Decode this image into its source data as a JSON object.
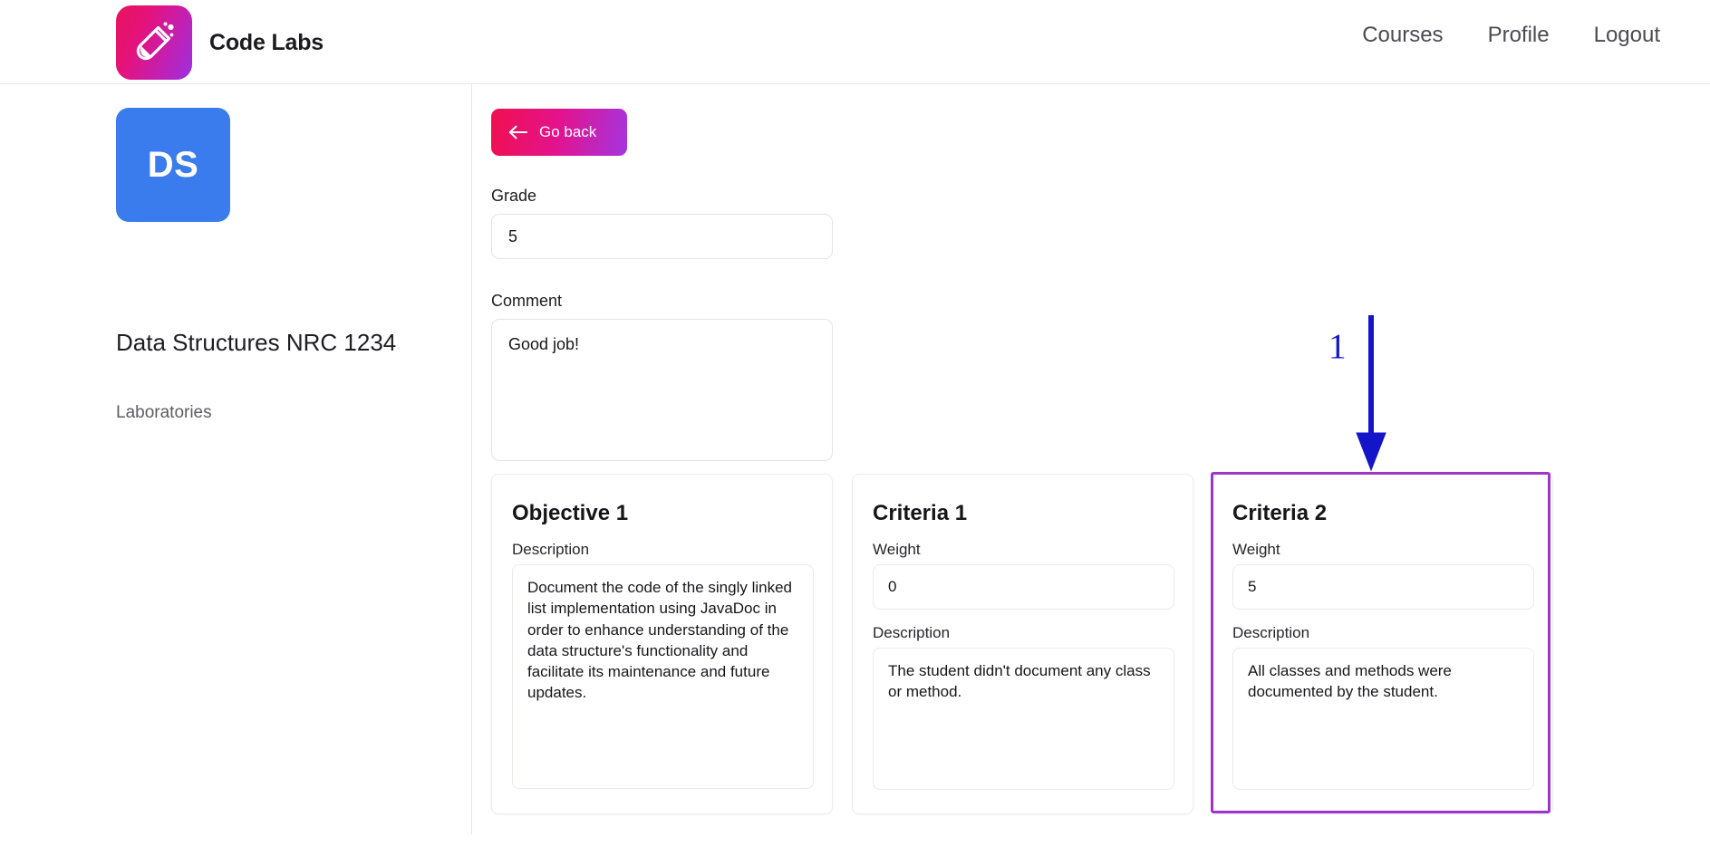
{
  "header": {
    "brand_name": "Code Labs",
    "logo_icon": "test-tube-icon",
    "nav": [
      {
        "label": "Courses"
      },
      {
        "label": "Profile"
      },
      {
        "label": "Logout"
      }
    ]
  },
  "sidebar": {
    "course_initials": "DS",
    "course_title": "Data Structures NRC 1234",
    "links": [
      {
        "label": "Laboratories"
      }
    ]
  },
  "main": {
    "go_back": {
      "label": "Go back",
      "icon": "arrow-left-icon"
    },
    "grade": {
      "label": "Grade",
      "value": "5"
    },
    "comment": {
      "label": "Comment",
      "value": "Good job!"
    },
    "objective_card": {
      "title": "Objective 1",
      "description_label": "Description",
      "description_value": "Document the code of the singly linked list implementation using JavaDoc in order to enhance understanding of the data structure's functionality and facilitate its maintenance and future updates."
    },
    "criteria_cards": [
      {
        "title": "Criteria 1",
        "weight_label": "Weight",
        "weight_value": "0",
        "description_label": "Description",
        "description_value": "The student didn't document any class or method."
      },
      {
        "title": "Criteria 2",
        "weight_label": "Weight",
        "weight_value": "5",
        "description_label": "Description",
        "description_value": "All classes and methods were documented by the student."
      }
    ]
  },
  "annotation": {
    "number": "1",
    "arrow_color": "#1414c8",
    "highlight_color": "#9b36c9",
    "target": "Criteria 2"
  },
  "colors": {
    "brand_gradient_start": "#e8145c",
    "brand_gradient_end": "#9b30e0",
    "course_tile": "#3a7ced",
    "text_primary": "#1d1d22",
    "text_muted": "#5d5d66"
  }
}
